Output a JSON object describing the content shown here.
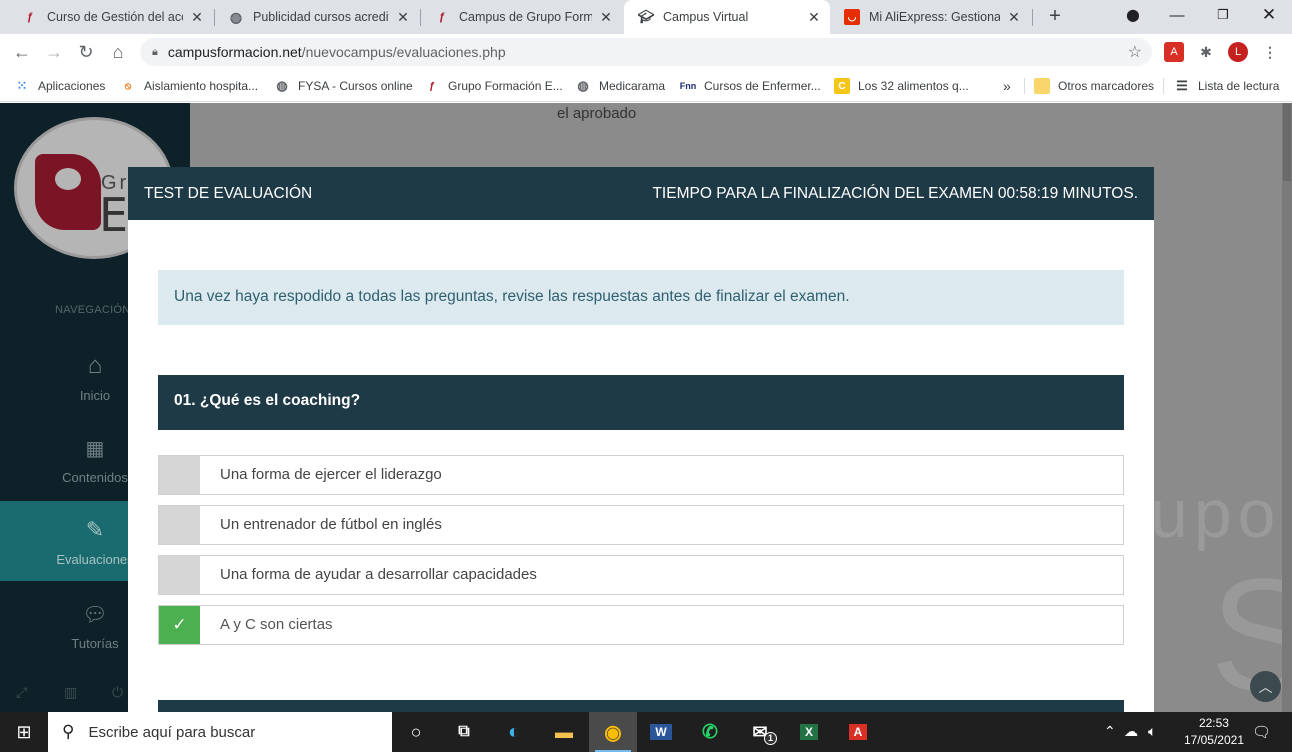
{
  "browser": {
    "tabs": [
      {
        "title": "Curso de Gestión del acce",
        "icon": "grupo-favicon",
        "active": false
      },
      {
        "title": "Publicidad cursos acredita",
        "icon": "globe-icon",
        "active": false
      },
      {
        "title": "Campus de Grupo Formac",
        "icon": "campus-favicon",
        "active": false
      },
      {
        "title": "Campus Virtual",
        "icon": "graduation-cap-icon",
        "active": true
      },
      {
        "title": "Mi AliExpress: Gestionar p",
        "icon": "aliexpress-favicon",
        "active": false
      }
    ],
    "new_tab": "+",
    "url_host": "campusformacion.net",
    "url_path": "/nuevocampus/evaluaciones.php",
    "profile_initial": "L",
    "bookmarks": [
      {
        "label": "Aplicaciones"
      },
      {
        "label": "Aislamiento hospita..."
      },
      {
        "label": "FYSA - Cursos online"
      },
      {
        "label": "Grupo Formación E..."
      },
      {
        "label": "Medicarama"
      },
      {
        "label": "Cursos de Enfermer..."
      },
      {
        "label": "Los 32 alimentos q..."
      },
      {
        "label": "Otros marcadores"
      },
      {
        "label": "Lista de lectura"
      }
    ],
    "bookmarks_more": "»"
  },
  "sidebar": {
    "logo_text1": "Gru",
    "logo_text2": "EC",
    "nav_label": "NAVEGACIÓN",
    "items": [
      {
        "label": "Inicio",
        "icon": "home-icon"
      },
      {
        "label": "Contenidos",
        "icon": "grid-icon"
      },
      {
        "label": "Evaluaciones",
        "icon": "edit-icon"
      },
      {
        "label": "Tutorías",
        "icon": "chat-icon"
      }
    ]
  },
  "background": {
    "text": "el aprobado",
    "watermark": "upo",
    "watermark2": "S"
  },
  "modal": {
    "title": "TEST DE EVALUACIÓN",
    "timer": "TIEMPO PARA LA FINALIZACIÓN DEL EXAMEN 00:58:19 MINUTOS.",
    "info": "Una vez haya respodido a todas las preguntas, revise las respuestas antes de finalizar el examen.",
    "question": "01. ¿Qué es el coaching?",
    "options": [
      {
        "text": "Una forma de ejercer el liderazgo",
        "checked": false
      },
      {
        "text": "Un entrenador de fútbol en inglés",
        "checked": false
      },
      {
        "text": "Una forma de ayudar a desarrollar capacidades",
        "checked": false
      },
      {
        "text": "A y C son ciertas",
        "checked": true
      }
    ],
    "check_mark": "✓"
  },
  "taskbar": {
    "search_placeholder": "Escribe aquí para buscar",
    "time": "22:53",
    "date": "17/05/2021",
    "mail_badge": "1"
  },
  "colors": {
    "sidebar": "#0f2128",
    "header": "#1f3a47",
    "active_nav": "#1a6b6f",
    "checked": "#4caf50"
  }
}
